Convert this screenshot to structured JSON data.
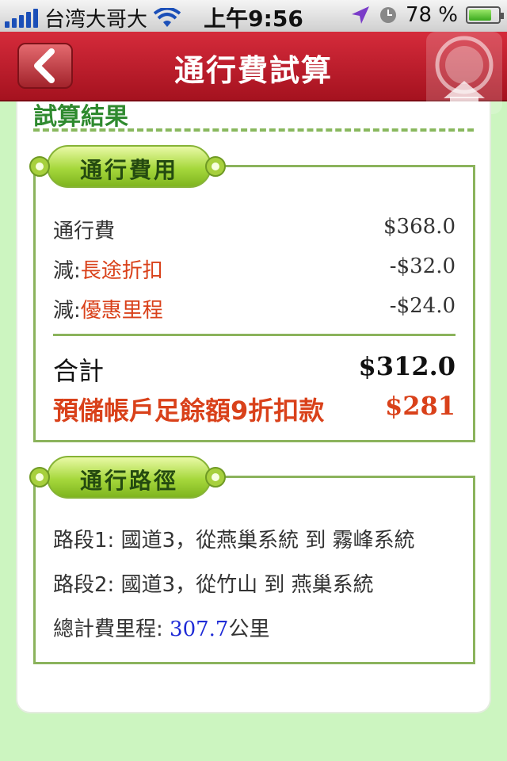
{
  "status": {
    "carrier": "台湾大哥大",
    "time": "上午9:56",
    "battery": "78 %",
    "battery_level": 0.78
  },
  "nav": {
    "title": "通行費試算"
  },
  "content": {
    "section_title": "試算結果",
    "fees": {
      "tag": "通行費用",
      "toll_label": "通行費",
      "toll_value": "$368.0",
      "long_prefix": "減:",
      "long_label": "長途折扣",
      "long_value": "-$32.0",
      "promo_prefix": "減:",
      "promo_label": "優惠里程",
      "promo_value": "-$24.0",
      "total_label": "合計",
      "total_value": "$312.0",
      "prepaid_label": "預儲帳戶足餘額9折扣款",
      "prepaid_value": "$281"
    },
    "route": {
      "tag": "通行路徑",
      "segment1": "路段1: 國道3，從燕巢系統 到 霧峰系統",
      "segment2": "路段2: 國道3，從竹山 到 燕巢系統",
      "distance_label": "總計費里程: ",
      "distance_value": "307.7",
      "distance_unit": "公里"
    }
  }
}
